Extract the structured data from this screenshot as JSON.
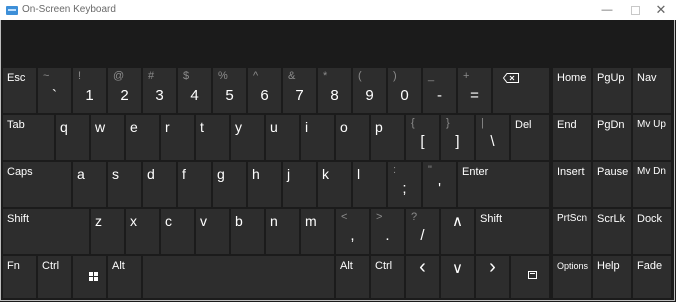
{
  "window": {
    "title": "On-Screen Keyboard",
    "minimize": "—",
    "close": "✕"
  },
  "row1": {
    "esc": "Esc",
    "keys": [
      {
        "shift": "~",
        "main": "`"
      },
      {
        "shift": "!",
        "main": "1"
      },
      {
        "shift": "@",
        "main": "2"
      },
      {
        "shift": "#",
        "main": "3"
      },
      {
        "shift": "$",
        "main": "4"
      },
      {
        "shift": "%",
        "main": "5"
      },
      {
        "shift": "^",
        "main": "6"
      },
      {
        "shift": "&",
        "main": "7"
      },
      {
        "shift": "*",
        "main": "8"
      },
      {
        "shift": "(",
        "main": "9"
      },
      {
        "shift": ")",
        "main": "0"
      },
      {
        "shift": "_",
        "main": "-"
      },
      {
        "shift": "+",
        "main": "="
      }
    ],
    "nav": [
      "Home",
      "PgUp",
      "Nav"
    ]
  },
  "row2": {
    "tab": "Tab",
    "letters": [
      "q",
      "w",
      "e",
      "r",
      "t",
      "y",
      "u",
      "i",
      "o",
      "p"
    ],
    "syms": [
      {
        "shift": "{",
        "main": "["
      },
      {
        "shift": "}",
        "main": "]"
      },
      {
        "shift": "|",
        "main": "\\"
      }
    ],
    "del": "Del",
    "nav": [
      "End",
      "PgDn",
      "Mv Up"
    ]
  },
  "row3": {
    "caps": "Caps",
    "letters": [
      "a",
      "s",
      "d",
      "f",
      "g",
      "h",
      "j",
      "k",
      "l"
    ],
    "syms": [
      {
        "shift": ":",
        "main": ";"
      },
      {
        "shift": "\"",
        "main": "'"
      }
    ],
    "enter": "Enter",
    "nav": [
      "Insert",
      "Pause",
      "Mv Dn"
    ]
  },
  "row4": {
    "shift_left": "Shift",
    "letters": [
      "z",
      "x",
      "c",
      "v",
      "b",
      "n",
      "m"
    ],
    "syms": [
      {
        "shift": "<",
        "main": ","
      },
      {
        "shift": ">",
        "main": "."
      },
      {
        "shift": "?",
        "main": "/"
      }
    ],
    "up_arrow": "∧",
    "shift_right": "Shift",
    "nav": [
      "PrtScn",
      "ScrLk",
      "Dock"
    ]
  },
  "row5": {
    "fn": "Fn",
    "ctrl_left": "Ctrl",
    "alt_left": "Alt",
    "alt_right": "Alt",
    "ctrl_right": "Ctrl",
    "left_arrow": "‹",
    "down_arrow": "∨",
    "right_arrow": "›",
    "nav": [
      "Options",
      "Help",
      "Fade"
    ]
  },
  "icons": [
    "windows-logo-icon",
    "backspace-icon",
    "keyboard-app-icon",
    "delete-icon"
  ],
  "colors": {
    "key_bg": "#2d2d2d",
    "board_bg": "#1b1b1b",
    "shift_text": "#8c8c8c",
    "text": "#ffffff"
  }
}
